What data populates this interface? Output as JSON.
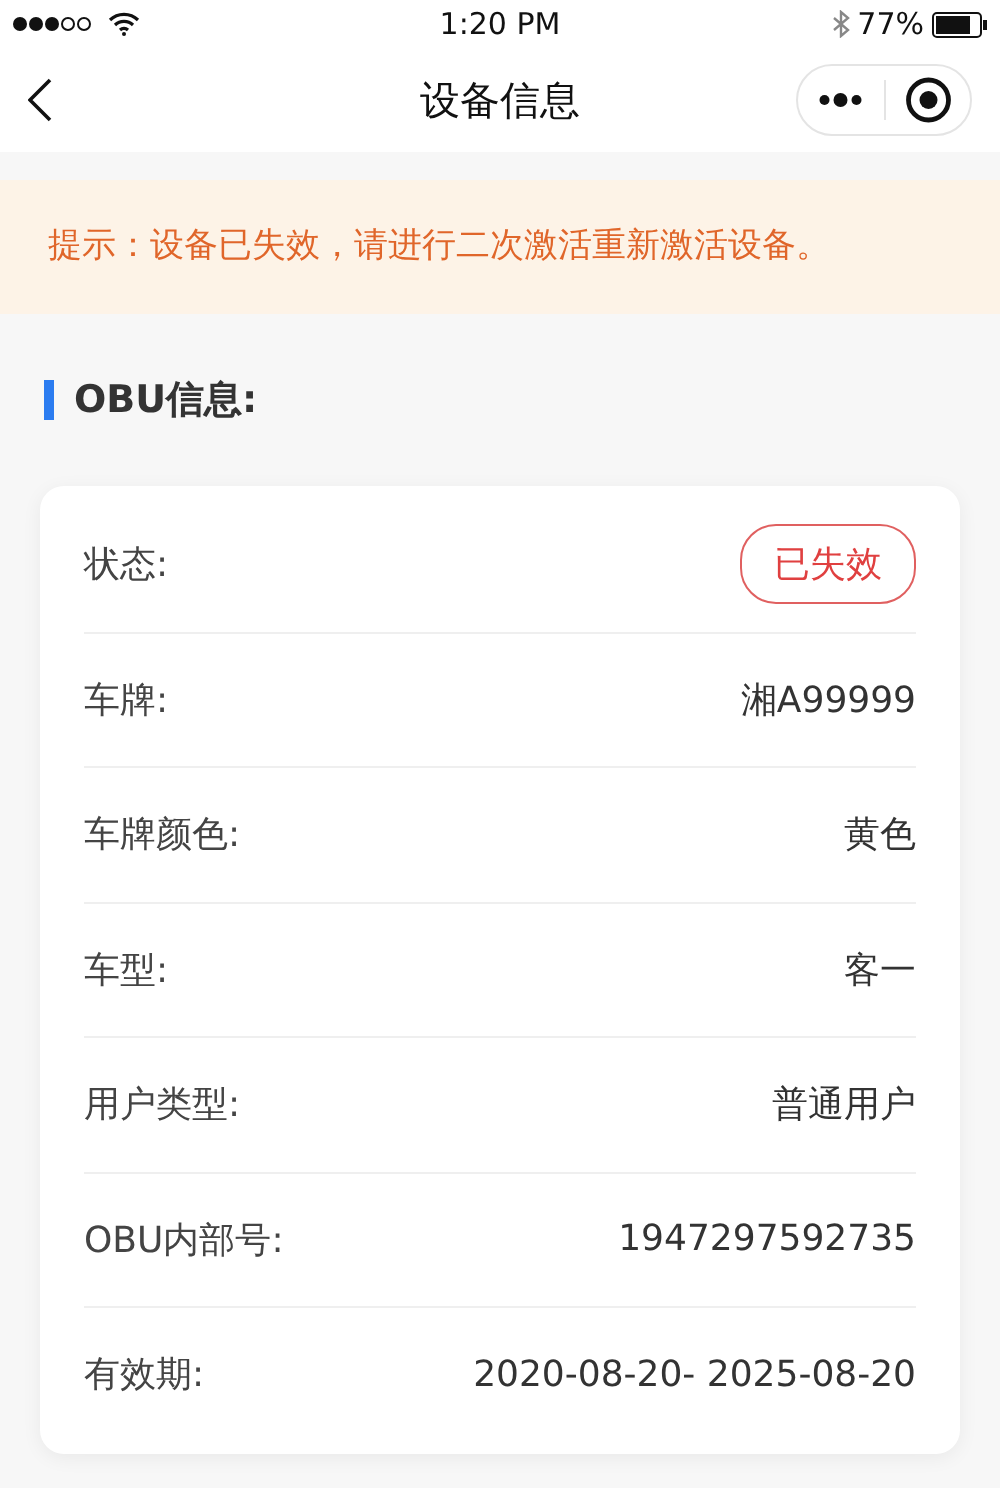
{
  "status_bar": {
    "time": "1:20 PM",
    "battery": "77%"
  },
  "nav_bar": {
    "title": "设备信息"
  },
  "notice": {
    "text": "提示：设备已失效，请进行二次激活重新激活设备。"
  },
  "section": {
    "title": "OBU信息:"
  },
  "rows": [
    {
      "kind": "badge",
      "label": "状态:",
      "value": "已失效"
    },
    {
      "kind": "text",
      "label": "车牌:",
      "value": "湘A99999"
    },
    {
      "kind": "text",
      "label": "车牌颜色:",
      "value": "黄色"
    },
    {
      "kind": "text",
      "label": "车型:",
      "value": "客一"
    },
    {
      "kind": "text",
      "label": "用户类型:",
      "value": "普通用户"
    },
    {
      "kind": "text",
      "label": "OBU内部号:",
      "value": "1947297592735"
    },
    {
      "kind": "text",
      "label": "有效期:",
      "value": "2020-08-20- 2025-08-20"
    }
  ]
}
